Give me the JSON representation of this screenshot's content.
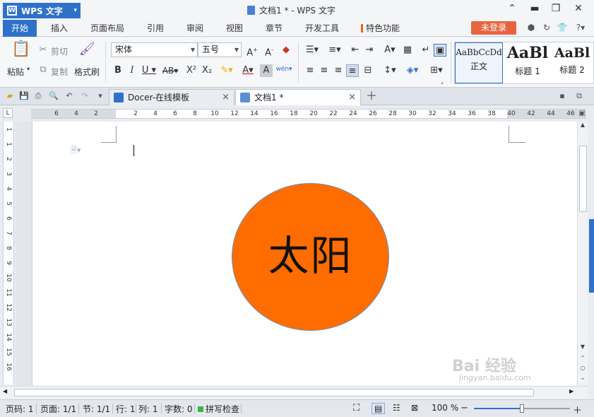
{
  "app": {
    "name": "WPS 文字",
    "doc_title": "文档1 * - WPS 文字"
  },
  "menu": {
    "items": [
      "开始",
      "插入",
      "页面布局",
      "引用",
      "审阅",
      "视图",
      "章节",
      "开发工具",
      "特色功能"
    ],
    "login": "未登录"
  },
  "ribbon": {
    "paste": "粘贴",
    "cut": "剪切",
    "copy": "复制",
    "format_painter": "格式刷",
    "font_name": "宋体",
    "font_size": "五号",
    "styles": [
      {
        "sample": "AaBbCcDd",
        "label": "正文"
      },
      {
        "sample": "AaBl",
        "label": "标题 1"
      },
      {
        "sample": "AaBl",
        "label": "标题 2"
      }
    ]
  },
  "tabs": [
    {
      "label": "Docer-在线模板",
      "close": "×"
    },
    {
      "label": "文档1 *",
      "close": "×"
    }
  ],
  "ruler": {
    "labels": [
      "6",
      "4",
      "2",
      "",
      "2",
      "4",
      "6",
      "8",
      "10",
      "12",
      "14",
      "16",
      "18",
      "20",
      "22",
      "24",
      "26",
      "28",
      "30",
      "32",
      "34",
      "36",
      "38",
      "40",
      "42",
      "44",
      "46"
    ],
    "vlabels": [
      "1",
      "1",
      "2",
      "3",
      "4",
      "5",
      "6",
      "7",
      "8",
      "9",
      "10",
      "11",
      "12",
      "13",
      "14",
      "15",
      "16"
    ]
  },
  "document": {
    "shape_text": "太阳",
    "shape_color": "#ff6c00"
  },
  "status": {
    "page": "页码: 1",
    "pages": "页面: 1/1",
    "section": "节: 1/1",
    "row": "行: 1",
    "col": "列: 1",
    "words": "字数: 0",
    "spell": "拼写检查",
    "zoom": "100 %",
    "zoom_level": 0.5
  },
  "watermark": {
    "text": "Bai 经验",
    "sub": "jingyan.baidu.com"
  },
  "colors": {
    "accent": "#2f71c9",
    "login": "#e8643e",
    "feature_mark": "#e8641b"
  }
}
